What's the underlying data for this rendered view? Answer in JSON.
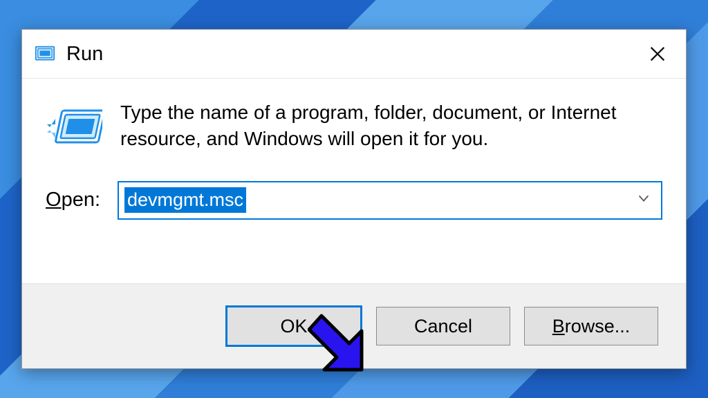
{
  "window": {
    "title": "Run",
    "description": "Type the name of a program, folder, document, or Internet resource, and Windows will open it for you."
  },
  "form": {
    "open_label_prefix": "O",
    "open_label_rest": "pen:",
    "open_value": "devmgmt.msc"
  },
  "buttons": {
    "ok": "OK",
    "cancel": "Cancel",
    "browse_prefix": "B",
    "browse_rest": "rowse..."
  }
}
